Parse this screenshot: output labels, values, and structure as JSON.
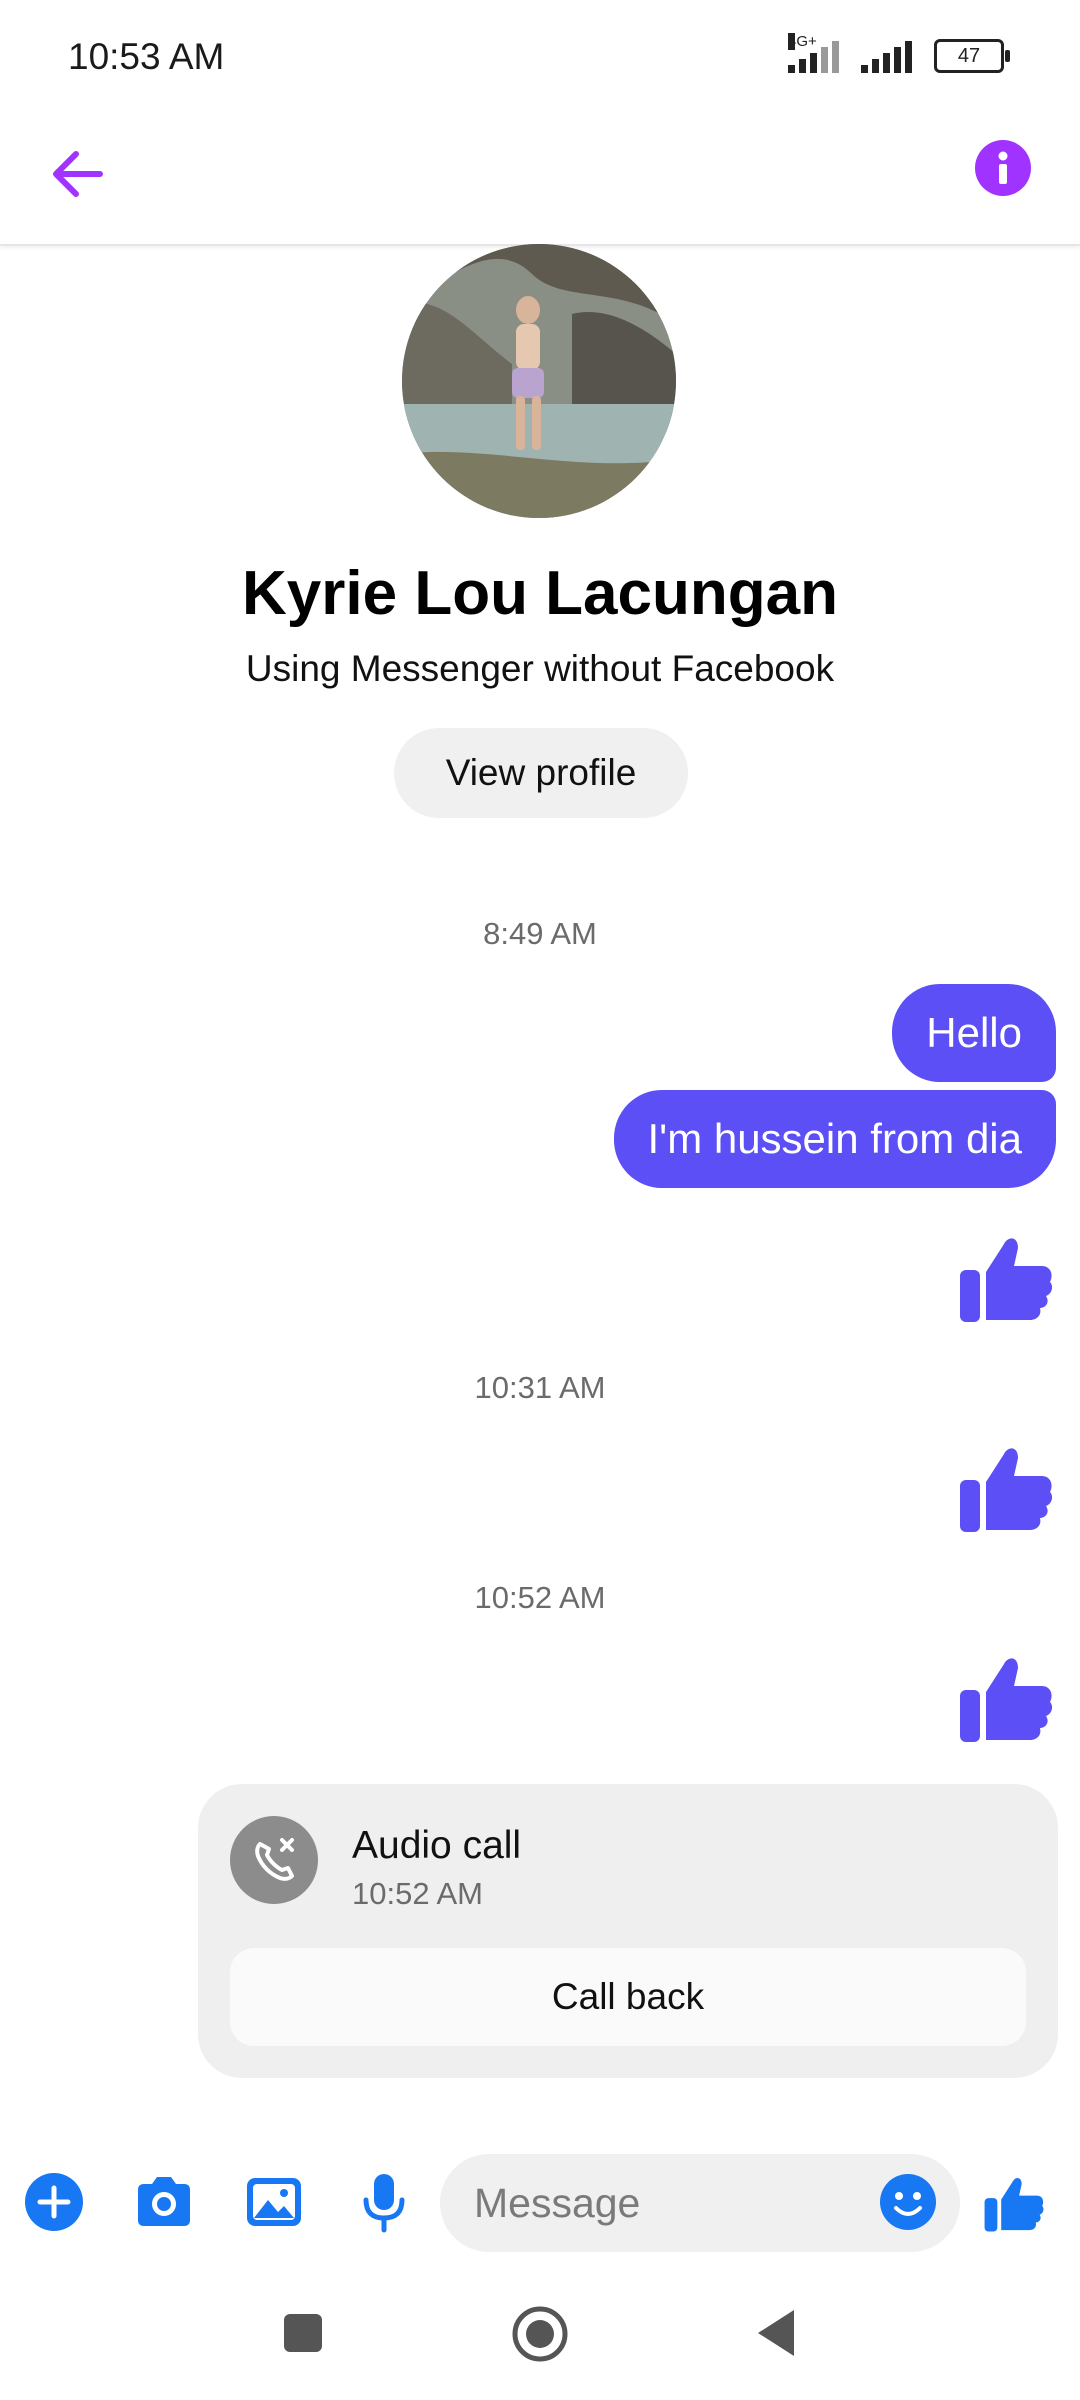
{
  "status_bar": {
    "time": "10:53 AM",
    "network": "4G+",
    "battery": "47"
  },
  "header": {
    "back_icon": "arrow-left-icon",
    "info_icon": "info-icon",
    "accent_color": "#a033ff"
  },
  "profile": {
    "name": "Kyrie Lou Lacungan",
    "subtitle": "Using Messenger without Facebook",
    "view_profile_label": "View profile"
  },
  "conversation": {
    "timestamps": [
      "8:49 AM",
      "10:31 AM",
      "10:52 AM"
    ],
    "messages": [
      {
        "type": "text",
        "text": "Hello"
      },
      {
        "type": "text",
        "text": "I'm hussein from dia"
      },
      {
        "type": "like"
      },
      {
        "type": "like"
      },
      {
        "type": "like"
      }
    ],
    "bubble_color": "#5b4ff5"
  },
  "call_card": {
    "title": "Audio call",
    "time": "10:52 AM",
    "button_label": "Call back",
    "icon": "missed-call-icon"
  },
  "composer": {
    "placeholder": "Message",
    "icons": [
      "plus-icon",
      "camera-icon",
      "gallery-icon",
      "microphone-icon",
      "emoji-icon",
      "thumbs-up-icon"
    ],
    "icon_color": "#1877f2"
  },
  "nav_bar": {
    "icons": [
      "recents-icon",
      "home-icon",
      "back-icon"
    ]
  }
}
